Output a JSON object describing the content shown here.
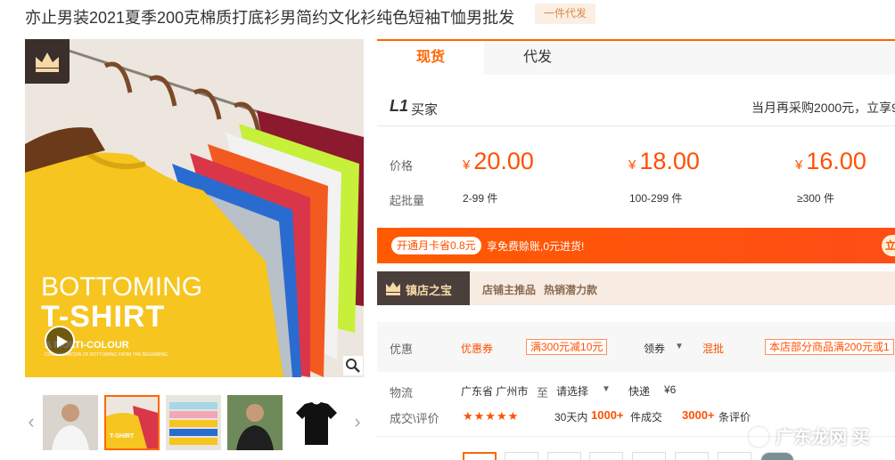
{
  "product": {
    "title": "亦止男装2021夏季200克棉质打底衫男简约文化衫纯色短袖T恤男批发",
    "badge": "一件代发"
  },
  "main_image": {
    "overlay_line1": "BOTTOMING",
    "overlay_line2": "T-SHIRT",
    "overlay_line3": "A MULTI-COLOUR",
    "overlay_line4": "CONSIDERATION OF BOTTOMING FROM THE BEGINNING"
  },
  "tabs": [
    {
      "label": "现货",
      "active": true
    },
    {
      "label": "代发",
      "active": false
    }
  ],
  "buyer": {
    "level": "L1",
    "label": "买家",
    "promo": "当月再采购2000元，立享9"
  },
  "pricing": {
    "price_label": "价格",
    "qty_label": "起批量",
    "currency": "¥",
    "tiers": [
      {
        "price": "20.00",
        "qty": "2-99 件"
      },
      {
        "price": "18.00",
        "qty": "100-299 件"
      },
      {
        "price": "16.00",
        "qty": "≥300 件"
      }
    ]
  },
  "member_bar": {
    "pill": "开通月卡省0.8元",
    "text": "享免费赊账,0元进货!",
    "right": "立"
  },
  "treasure": {
    "label": "镇店之宝",
    "t1": "店铺主推品",
    "t2": "热销潜力款"
  },
  "discount": {
    "label": "优惠",
    "coupon_type": "优惠券",
    "coupon_value": "满300元减10元",
    "claim": "领券",
    "mixed": "混批",
    "store_deal": "本店部分商品满200元或1"
  },
  "logistics": {
    "label": "物流",
    "from": "广东省 广州市",
    "to_word": "至",
    "select": "请选择",
    "express": "快递",
    "fee": "¥6"
  },
  "reviews": {
    "label": "成交\\评价",
    "stars": "★★★★★",
    "period": "30天内",
    "deals_num": "1000+",
    "deals_word": "件成交",
    "reviews_num": "3000+",
    "reviews_word": "条评价"
  },
  "watermark": {
    "text": "广东龙网",
    "suffix": "买"
  },
  "colors": {
    "accent": "#ff5000",
    "tab_border": "#ff6600",
    "treasure_dark": "#4a3f3a"
  }
}
